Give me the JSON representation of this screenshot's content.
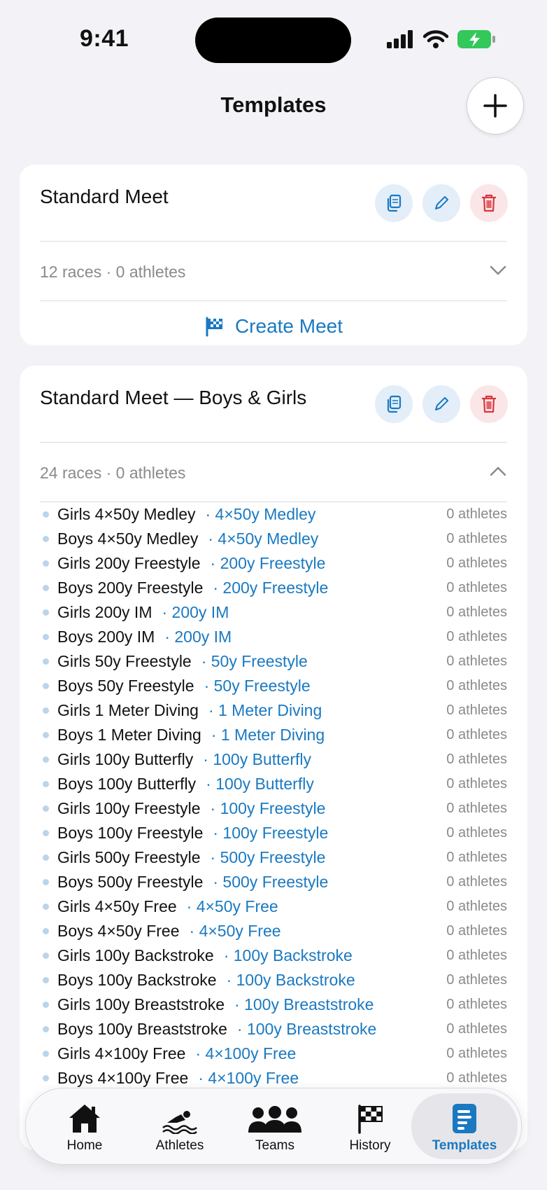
{
  "status_bar": {
    "time": "9:41"
  },
  "header": {
    "title": "Templates"
  },
  "colors": {
    "accent": "#1a79c1",
    "danger": "#d9363e",
    "background": "#f2f2f7"
  },
  "templates": [
    {
      "title": "Standard Meet",
      "summary": "12 races · 0 athletes",
      "expanded": false,
      "create_label": "Create Meet"
    },
    {
      "title": "Standard Meet — Boys & Girls",
      "summary": "24 races · 0 athletes",
      "expanded": true,
      "races": [
        {
          "name": "Girls 4×50y Medley",
          "type": "· 4×50y Medley",
          "count": "0 athletes"
        },
        {
          "name": "Boys 4×50y Medley",
          "type": "· 4×50y Medley",
          "count": "0 athletes"
        },
        {
          "name": "Girls 200y Freestyle",
          "type": "· 200y Freestyle",
          "count": "0 athletes"
        },
        {
          "name": "Boys 200y Freestyle",
          "type": "· 200y Freestyle",
          "count": "0 athletes"
        },
        {
          "name": "Girls 200y IM",
          "type": "· 200y IM",
          "count": "0 athletes"
        },
        {
          "name": "Boys 200y IM",
          "type": "· 200y IM",
          "count": "0 athletes"
        },
        {
          "name": "Girls 50y Freestyle",
          "type": "· 50y Freestyle",
          "count": "0 athletes"
        },
        {
          "name": "Boys 50y Freestyle",
          "type": "· 50y Freestyle",
          "count": "0 athletes"
        },
        {
          "name": "Girls 1 Meter Diving",
          "type": "· 1 Meter Diving",
          "count": "0 athletes"
        },
        {
          "name": "Boys 1 Meter Diving",
          "type": "· 1 Meter Diving",
          "count": "0 athletes"
        },
        {
          "name": "Girls 100y Butterfly",
          "type": "· 100y Butterfly",
          "count": "0 athletes"
        },
        {
          "name": "Boys 100y Butterfly",
          "type": "· 100y Butterfly",
          "count": "0 athletes"
        },
        {
          "name": "Girls 100y Freestyle",
          "type": "· 100y Freestyle",
          "count": "0 athletes"
        },
        {
          "name": "Boys 100y Freestyle",
          "type": "· 100y Freestyle",
          "count": "0 athletes"
        },
        {
          "name": "Girls 500y Freestyle",
          "type": "· 500y Freestyle",
          "count": "0 athletes"
        },
        {
          "name": "Boys 500y Freestyle",
          "type": "· 500y Freestyle",
          "count": "0 athletes"
        },
        {
          "name": "Girls 4×50y Free",
          "type": "· 4×50y Free",
          "count": "0 athletes"
        },
        {
          "name": "Boys 4×50y Free",
          "type": "· 4×50y Free",
          "count": "0 athletes"
        },
        {
          "name": "Girls 100y Backstroke",
          "type": "· 100y Backstroke",
          "count": "0 athletes"
        },
        {
          "name": "Boys 100y Backstroke",
          "type": "· 100y Backstroke",
          "count": "0 athletes"
        },
        {
          "name": "Girls 100y Breaststroke",
          "type": "· 100y Breaststroke",
          "count": "0 athletes"
        },
        {
          "name": "Boys 100y Breaststroke",
          "type": "· 100y Breaststroke",
          "count": "0 athletes"
        },
        {
          "name": "Girls 4×100y Free",
          "type": "· 4×100y Free",
          "count": "0 athletes"
        },
        {
          "name": "Boys 4×100y Free",
          "type": "· 4×100y Free",
          "count": "0 athletes"
        }
      ]
    }
  ],
  "tabs": [
    {
      "label": "Home",
      "icon": "house-icon"
    },
    {
      "label": "Athletes",
      "icon": "swimmer-icon"
    },
    {
      "label": "Teams",
      "icon": "people-icon"
    },
    {
      "label": "History",
      "icon": "checkered-flag-icon"
    },
    {
      "label": "Templates",
      "icon": "document-icon",
      "active": true
    }
  ]
}
